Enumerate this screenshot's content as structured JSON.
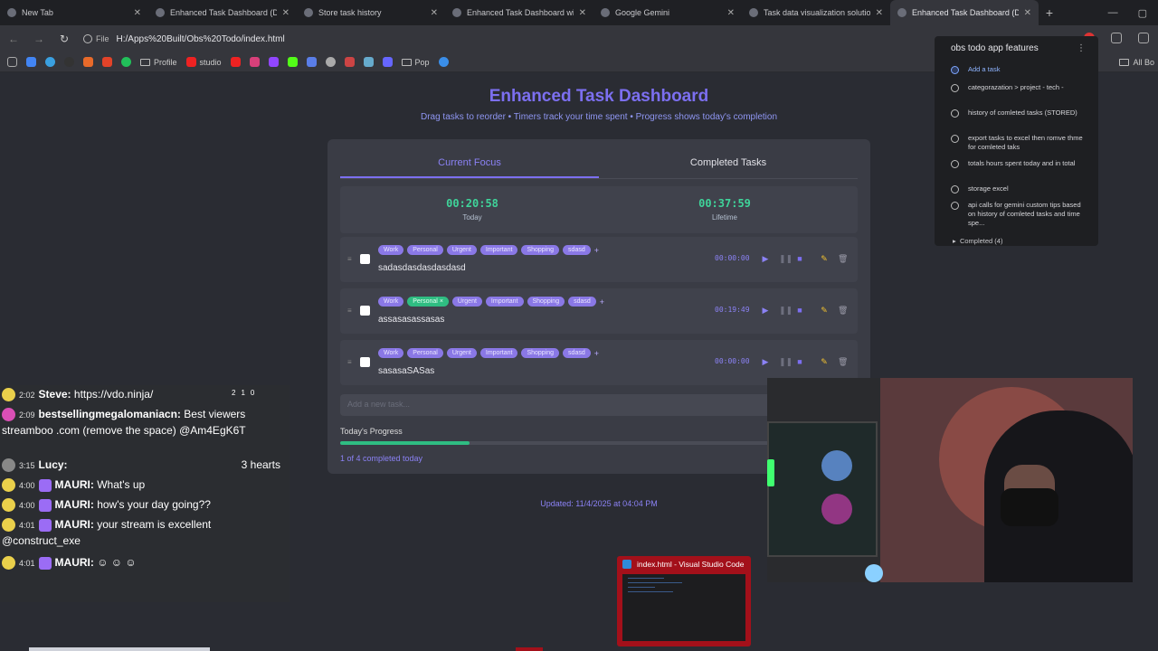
{
  "browser": {
    "tabs": [
      {
        "title": "New Tab",
        "active": false
      },
      {
        "title": "Enhanced Task Dashboard (Da",
        "active": false
      },
      {
        "title": "Store task history",
        "active": false
      },
      {
        "title": "Enhanced Task Dashboard with",
        "active": false
      },
      {
        "title": "Google Gemini",
        "active": false
      },
      {
        "title": "Task data visualization solution",
        "active": false
      },
      {
        "title": "Enhanced Task Dashboard (Da",
        "active": true
      }
    ],
    "url_chip": "File",
    "url": "H:/Apps%20Built/Obs%20Todo/index.html",
    "bookmarks": [
      "Profile",
      "studio",
      "Pop"
    ],
    "all_bookmarks": "All Bo"
  },
  "dashboard": {
    "title": "Enhanced Task Dashboard",
    "subtitle": "Drag tasks to reorder • Timers track your time spent • Progress shows today's completion",
    "tabs": [
      "Current Focus",
      "Completed Tasks"
    ],
    "timers": {
      "today": {
        "value": "00:20:58",
        "label": "Today"
      },
      "lifetime": {
        "value": "00:37:59",
        "label": "Lifetime"
      }
    },
    "tag_options": [
      "Work",
      "Personal",
      "Urgent",
      "Important",
      "Shopping",
      "sdasd"
    ],
    "tag_add": "+",
    "tasks": [
      {
        "name": "sadasdasdasdasdasd",
        "time": "00:00:00",
        "selected_tag": ""
      },
      {
        "name": "assasasassasas",
        "time": "00:19:49",
        "selected_tag": "Personal"
      },
      {
        "name": "sasasaSASas",
        "time": "00:00:00",
        "selected_tag": ""
      }
    ],
    "selected_tag_remove": "×",
    "new_task_placeholder": "Add a new task...",
    "progress": {
      "label": "Today's Progress",
      "fraction": 0.25,
      "text": "1 of 4 completed today"
    },
    "updated": "Updated: 11/4/2025 at 04:04 PM"
  },
  "gemini_panel": {
    "header": "obs todo app features",
    "items": [
      {
        "text": "Add a task",
        "done": true
      },
      {
        "text": "categorazation > project - tech -",
        "done": false
      },
      {
        "text": "history of comleted tasks (STORED)",
        "done": false
      },
      {
        "text": "export tasks to excel then romve thme for comleted taks",
        "done": false
      },
      {
        "text": "totals hours spent today and in total",
        "done": false
      },
      {
        "text": "storage excel",
        "done": false
      },
      {
        "text": "api calls for gemini custom tips based on history of comleted tasks and time spe...",
        "done": false
      }
    ],
    "completed": "Completed (4)"
  },
  "chat": {
    "icon_counts": [
      "2",
      "1",
      "0"
    ],
    "messages": [
      {
        "time": "2:02",
        "name": "Steve:",
        "text": "https://vdo.ninja/",
        "avatar": "yellow",
        "badge": false,
        "extra": ""
      },
      {
        "time": "2:09",
        "name": "bestsellingmegalomaniacn:",
        "text": "Best viewers streamboo .com (remove the space) @Am4EgK6T",
        "avatar": "pink",
        "badge": false,
        "extra": ""
      },
      {
        "time": "3:15",
        "name": "Lucy:",
        "text": "",
        "avatar": "grey",
        "badge": false,
        "extra": "3 hearts"
      },
      {
        "time": "4:00",
        "name": "MAURI:",
        "text": "What's up",
        "avatar": "yellow",
        "badge": true,
        "extra": ""
      },
      {
        "time": "4:00",
        "name": "MAURI:",
        "text": "how's your day going??",
        "avatar": "yellow",
        "badge": true,
        "extra": ""
      },
      {
        "time": "4:01",
        "name": "MAURI:",
        "text": "your stream is excellent @construct_exe",
        "avatar": "yellow",
        "badge": true,
        "extra": ""
      },
      {
        "time": "4:01",
        "name": "MAURI:",
        "text": "",
        "avatar": "yellow",
        "badge": true,
        "extra": ""
      }
    ]
  },
  "vscode": {
    "title": "index.html - Visual Studio Code"
  },
  "colors": {
    "accent": "#7c6ff0",
    "timer": "#3fd49a",
    "tag": "#8a78e6",
    "progress": "#2fbd82"
  }
}
